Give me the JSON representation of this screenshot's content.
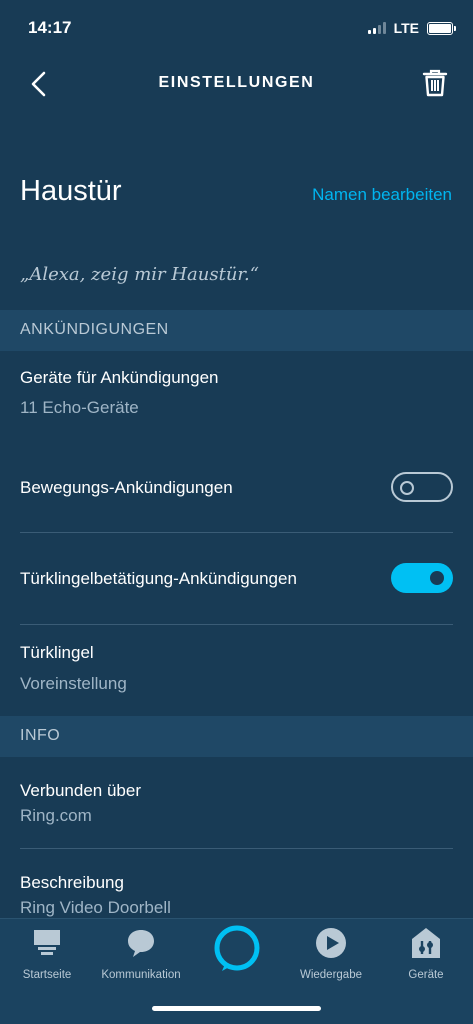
{
  "status_bar": {
    "time": "14:17",
    "network": "LTE"
  },
  "header": {
    "title": "EINSTELLUNGEN"
  },
  "device": {
    "name": "Haustür",
    "edit_label": "Namen bearbeiten",
    "voice_hint": "„Alexa, zeig mir Haustür.“"
  },
  "announcements": {
    "section_title": "ANKÜNDIGUNGEN",
    "devices_title": "Geräte für Ankündigungen",
    "devices_value": "11 Echo-Geräte",
    "motion_label": "Bewegungs-Ankündigungen",
    "motion_enabled": false,
    "doorbell_label": "Türklingelbetätigung-Ankündigungen",
    "doorbell_enabled": true,
    "chime_title": "Türklingel",
    "chime_value": "Voreinstellung"
  },
  "info": {
    "section_title": "INFO",
    "connected_title": "Verbunden über",
    "connected_value": "Ring.com",
    "description_title": "Beschreibung",
    "description_value": "Ring Video Doorbell"
  },
  "nav": {
    "items": [
      {
        "label": "Startseite",
        "icon": "home-icon"
      },
      {
        "label": "Kommunikation",
        "icon": "chat-bubble-icon"
      },
      {
        "label": "",
        "icon": "alexa-ring-icon"
      },
      {
        "label": "Wiedergabe",
        "icon": "play-icon"
      },
      {
        "label": "Geräte",
        "icon": "devices-icon"
      }
    ]
  },
  "colors": {
    "background": "#183b55",
    "section": "#1f4866",
    "accent": "#00c0f3",
    "link": "#00b5f0"
  }
}
